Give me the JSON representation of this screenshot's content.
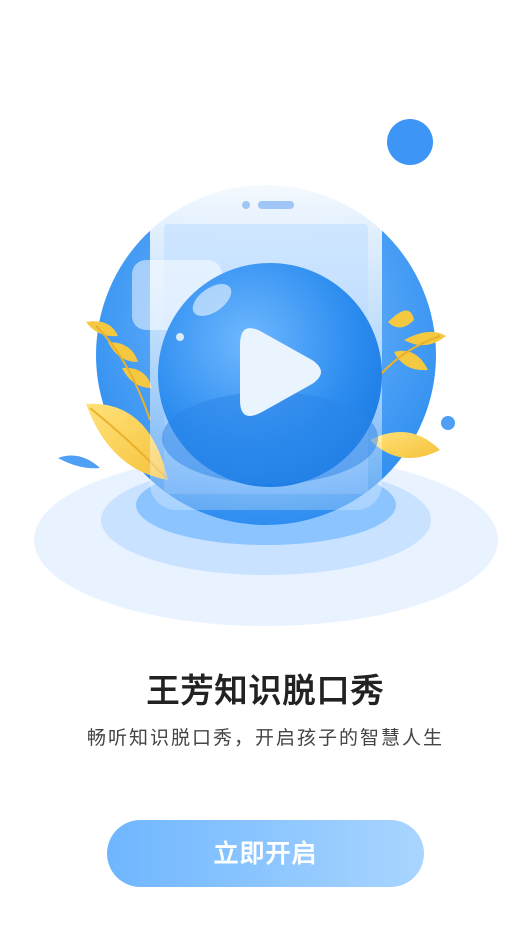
{
  "intro": {
    "title": "王芳知识脱口秀",
    "subtitle": "畅听知识脱口秀，开启孩子的智慧人生",
    "start_button_label": "立即开启"
  },
  "illustration": {
    "icon": "play-icon",
    "primary_color": "#3d95f5",
    "accent_color": "#f5c842"
  }
}
